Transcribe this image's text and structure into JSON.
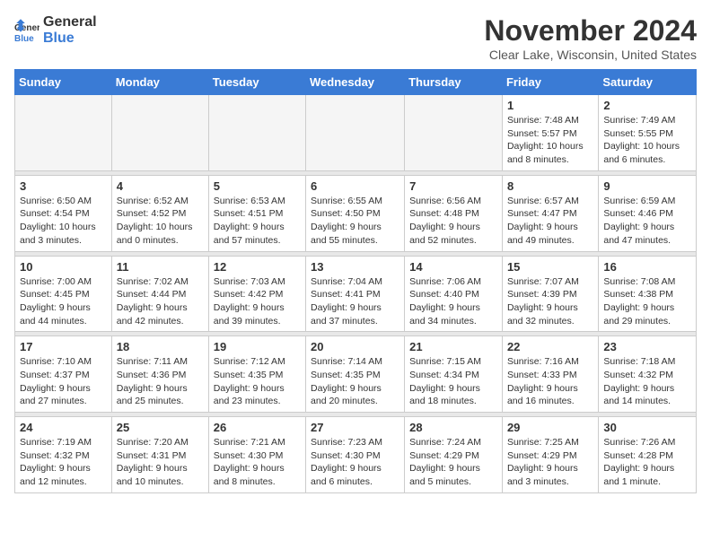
{
  "logo": {
    "general": "General",
    "blue": "Blue"
  },
  "header": {
    "month": "November 2024",
    "location": "Clear Lake, Wisconsin, United States"
  },
  "weekdays": [
    "Sunday",
    "Monday",
    "Tuesday",
    "Wednesday",
    "Thursday",
    "Friday",
    "Saturday"
  ],
  "weeks": [
    [
      {
        "day": "",
        "info": ""
      },
      {
        "day": "",
        "info": ""
      },
      {
        "day": "",
        "info": ""
      },
      {
        "day": "",
        "info": ""
      },
      {
        "day": "",
        "info": ""
      },
      {
        "day": "1",
        "info": "Sunrise: 7:48 AM\nSunset: 5:57 PM\nDaylight: 10 hours and 8 minutes."
      },
      {
        "day": "2",
        "info": "Sunrise: 7:49 AM\nSunset: 5:55 PM\nDaylight: 10 hours and 6 minutes."
      }
    ],
    [
      {
        "day": "3",
        "info": "Sunrise: 6:50 AM\nSunset: 4:54 PM\nDaylight: 10 hours and 3 minutes."
      },
      {
        "day": "4",
        "info": "Sunrise: 6:52 AM\nSunset: 4:52 PM\nDaylight: 10 hours and 0 minutes."
      },
      {
        "day": "5",
        "info": "Sunrise: 6:53 AM\nSunset: 4:51 PM\nDaylight: 9 hours and 57 minutes."
      },
      {
        "day": "6",
        "info": "Sunrise: 6:55 AM\nSunset: 4:50 PM\nDaylight: 9 hours and 55 minutes."
      },
      {
        "day": "7",
        "info": "Sunrise: 6:56 AM\nSunset: 4:48 PM\nDaylight: 9 hours and 52 minutes."
      },
      {
        "day": "8",
        "info": "Sunrise: 6:57 AM\nSunset: 4:47 PM\nDaylight: 9 hours and 49 minutes."
      },
      {
        "day": "9",
        "info": "Sunrise: 6:59 AM\nSunset: 4:46 PM\nDaylight: 9 hours and 47 minutes."
      }
    ],
    [
      {
        "day": "10",
        "info": "Sunrise: 7:00 AM\nSunset: 4:45 PM\nDaylight: 9 hours and 44 minutes."
      },
      {
        "day": "11",
        "info": "Sunrise: 7:02 AM\nSunset: 4:44 PM\nDaylight: 9 hours and 42 minutes."
      },
      {
        "day": "12",
        "info": "Sunrise: 7:03 AM\nSunset: 4:42 PM\nDaylight: 9 hours and 39 minutes."
      },
      {
        "day": "13",
        "info": "Sunrise: 7:04 AM\nSunset: 4:41 PM\nDaylight: 9 hours and 37 minutes."
      },
      {
        "day": "14",
        "info": "Sunrise: 7:06 AM\nSunset: 4:40 PM\nDaylight: 9 hours and 34 minutes."
      },
      {
        "day": "15",
        "info": "Sunrise: 7:07 AM\nSunset: 4:39 PM\nDaylight: 9 hours and 32 minutes."
      },
      {
        "day": "16",
        "info": "Sunrise: 7:08 AM\nSunset: 4:38 PM\nDaylight: 9 hours and 29 minutes."
      }
    ],
    [
      {
        "day": "17",
        "info": "Sunrise: 7:10 AM\nSunset: 4:37 PM\nDaylight: 9 hours and 27 minutes."
      },
      {
        "day": "18",
        "info": "Sunrise: 7:11 AM\nSunset: 4:36 PM\nDaylight: 9 hours and 25 minutes."
      },
      {
        "day": "19",
        "info": "Sunrise: 7:12 AM\nSunset: 4:35 PM\nDaylight: 9 hours and 23 minutes."
      },
      {
        "day": "20",
        "info": "Sunrise: 7:14 AM\nSunset: 4:35 PM\nDaylight: 9 hours and 20 minutes."
      },
      {
        "day": "21",
        "info": "Sunrise: 7:15 AM\nSunset: 4:34 PM\nDaylight: 9 hours and 18 minutes."
      },
      {
        "day": "22",
        "info": "Sunrise: 7:16 AM\nSunset: 4:33 PM\nDaylight: 9 hours and 16 minutes."
      },
      {
        "day": "23",
        "info": "Sunrise: 7:18 AM\nSunset: 4:32 PM\nDaylight: 9 hours and 14 minutes."
      }
    ],
    [
      {
        "day": "24",
        "info": "Sunrise: 7:19 AM\nSunset: 4:32 PM\nDaylight: 9 hours and 12 minutes."
      },
      {
        "day": "25",
        "info": "Sunrise: 7:20 AM\nSunset: 4:31 PM\nDaylight: 9 hours and 10 minutes."
      },
      {
        "day": "26",
        "info": "Sunrise: 7:21 AM\nSunset: 4:30 PM\nDaylight: 9 hours and 8 minutes."
      },
      {
        "day": "27",
        "info": "Sunrise: 7:23 AM\nSunset: 4:30 PM\nDaylight: 9 hours and 6 minutes."
      },
      {
        "day": "28",
        "info": "Sunrise: 7:24 AM\nSunset: 4:29 PM\nDaylight: 9 hours and 5 minutes."
      },
      {
        "day": "29",
        "info": "Sunrise: 7:25 AM\nSunset: 4:29 PM\nDaylight: 9 hours and 3 minutes."
      },
      {
        "day": "30",
        "info": "Sunrise: 7:26 AM\nSunset: 4:28 PM\nDaylight: 9 hours and 1 minute."
      }
    ]
  ]
}
